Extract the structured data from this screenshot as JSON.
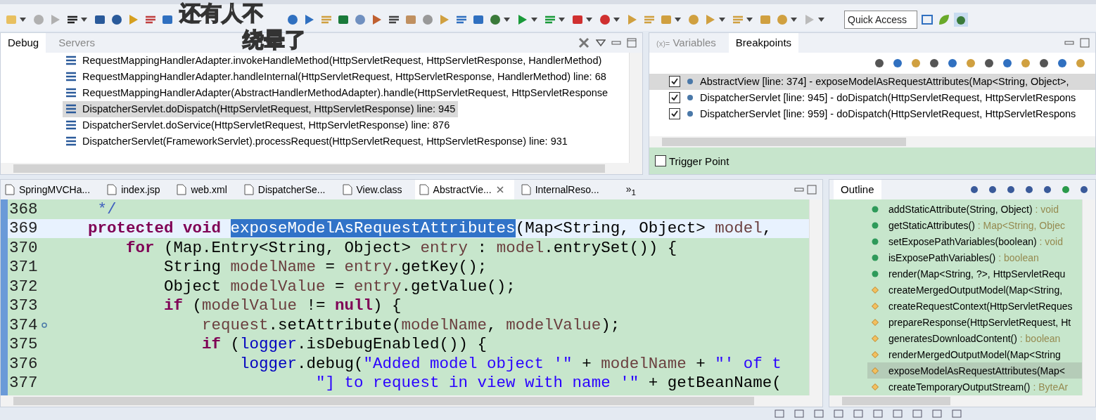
{
  "captions": [
    "还有人不",
    "绕晕了"
  ],
  "toolbar": {
    "quick_access": {
      "placeholder": "Quick Access"
    }
  },
  "debug_panel": {
    "tabs": [
      {
        "label": "Debug",
        "selected": true
      },
      {
        "label": "Servers",
        "selected": false
      }
    ],
    "frames": [
      {
        "text": "RequestMappingHandlerAdapter.invokeHandleMethod(HttpServletRequest, HttpServletResponse, HandlerMethod)",
        "selected": false
      },
      {
        "text": "RequestMappingHandlerAdapter.handleInternal(HttpServletRequest, HttpServletResponse, HandlerMethod) line: 68",
        "selected": false
      },
      {
        "text": "RequestMappingHandlerAdapter(AbstractHandlerMethodAdapter).handle(HttpServletRequest, HttpServletResponse",
        "selected": false
      },
      {
        "text": "DispatcherServlet.doDispatch(HttpServletRequest, HttpServletResponse) line: 945",
        "selected": true
      },
      {
        "text": "DispatcherServlet.doService(HttpServletRequest, HttpServletResponse) line: 876",
        "selected": false
      },
      {
        "text": "DispatcherServlet(FrameworkServlet).processRequest(HttpServletRequest, HttpServletResponse) line: 931",
        "selected": false
      }
    ]
  },
  "breakpoints_panel": {
    "tabs": [
      {
        "label": "Variables",
        "prefix": "(x)=",
        "selected": false
      },
      {
        "label": "Breakpoints",
        "selected": true
      }
    ],
    "breakpoints": [
      {
        "text": "AbstractView [line: 374] - exposeModelAsRequestAttributes(Map<String, Object>,",
        "checked": true,
        "selected": true
      },
      {
        "text": "DispatcherServlet [line: 945] - doDispatch(HttpServletRequest, HttpServletRespons",
        "checked": true,
        "selected": false
      },
      {
        "text": "DispatcherServlet [line: 959] - doDispatch(HttpServletRequest, HttpServletRespons",
        "checked": true,
        "selected": false
      }
    ],
    "trigger_point": {
      "label": "Trigger Point",
      "checked": false
    }
  },
  "editor": {
    "tabs": [
      {
        "label": "SpringMVCHa...",
        "selected": false
      },
      {
        "label": "index.jsp",
        "selected": false
      },
      {
        "label": "web.xml",
        "selected": false
      },
      {
        "label": "DispatcherSe...",
        "selected": false
      },
      {
        "label": "View.class",
        "selected": false
      },
      {
        "label": "AbstractVie...",
        "selected": true
      },
      {
        "label": "InternalReso...",
        "selected": false
      }
    ],
    "overflow": {
      "chevron": "»",
      "count": "1"
    },
    "lines": [
      {
        "number": "368",
        "current": false,
        "breakpoint": false,
        "segments": [
          {
            "text": "     */",
            "kind": "comment"
          }
        ]
      },
      {
        "number": "369",
        "current": true,
        "breakpoint": false,
        "segments": [
          {
            "text": "    protected void ",
            "kind": "keyword"
          },
          {
            "text": "exposeModelAsRequestAttributes",
            "kind": "selection"
          },
          {
            "text": "(Map<String, Object> ",
            "kind": "plain"
          },
          {
            "text": "model",
            "kind": "local"
          },
          {
            "text": ",",
            "kind": "plain"
          }
        ]
      },
      {
        "number": "370",
        "current": false,
        "breakpoint": false,
        "segments": [
          {
            "text": "        for",
            "kind": "keyword"
          },
          {
            "text": " (Map.Entry<String, Object> ",
            "kind": "plain"
          },
          {
            "text": "entry",
            "kind": "local"
          },
          {
            "text": " : ",
            "kind": "plain"
          },
          {
            "text": "model",
            "kind": "local"
          },
          {
            "text": ".entrySet()) {",
            "kind": "plain"
          }
        ]
      },
      {
        "number": "371",
        "current": false,
        "breakpoint": false,
        "segments": [
          {
            "text": "            String ",
            "kind": "plain"
          },
          {
            "text": "modelName",
            "kind": "local"
          },
          {
            "text": " = ",
            "kind": "plain"
          },
          {
            "text": "entry",
            "kind": "local"
          },
          {
            "text": ".getKey();",
            "kind": "plain"
          }
        ]
      },
      {
        "number": "372",
        "current": false,
        "breakpoint": false,
        "segments": [
          {
            "text": "            Object ",
            "kind": "plain"
          },
          {
            "text": "modelValue",
            "kind": "local"
          },
          {
            "text": " = ",
            "kind": "plain"
          },
          {
            "text": "entry",
            "kind": "local"
          },
          {
            "text": ".getValue();",
            "kind": "plain"
          }
        ]
      },
      {
        "number": "373",
        "current": false,
        "breakpoint": false,
        "segments": [
          {
            "text": "            if",
            "kind": "keyword"
          },
          {
            "text": " (",
            "kind": "plain"
          },
          {
            "text": "modelValue",
            "kind": "local"
          },
          {
            "text": " != ",
            "kind": "plain"
          },
          {
            "text": "null",
            "kind": "keyword"
          },
          {
            "text": ") {",
            "kind": "plain"
          }
        ]
      },
      {
        "number": "374",
        "current": false,
        "breakpoint": true,
        "segments": [
          {
            "text": "                request",
            "kind": "local"
          },
          {
            "text": ".setAttribute(",
            "kind": "plain"
          },
          {
            "text": "modelName",
            "kind": "local"
          },
          {
            "text": ", ",
            "kind": "plain"
          },
          {
            "text": "modelValue",
            "kind": "local"
          },
          {
            "text": ");",
            "kind": "plain"
          }
        ]
      },
      {
        "number": "375",
        "current": false,
        "breakpoint": false,
        "segments": [
          {
            "text": "                if",
            "kind": "keyword"
          },
          {
            "text": " (",
            "kind": "plain"
          },
          {
            "text": "logger",
            "kind": "field"
          },
          {
            "text": ".isDebugEnabled()) {",
            "kind": "plain"
          }
        ]
      },
      {
        "number": "376",
        "current": false,
        "breakpoint": false,
        "segments": [
          {
            "text": "                    logger",
            "kind": "field"
          },
          {
            "text": ".debug(",
            "kind": "plain"
          },
          {
            "text": "\"Added model object '\"",
            "kind": "string"
          },
          {
            "text": " + ",
            "kind": "plain"
          },
          {
            "text": "modelName",
            "kind": "local"
          },
          {
            "text": " + ",
            "kind": "plain"
          },
          {
            "text": "\"' of t",
            "kind": "string"
          }
        ]
      },
      {
        "number": "377",
        "current": false,
        "breakpoint": false,
        "segments": [
          {
            "text": "                            \"] to request in view with name '\"",
            "kind": "string"
          },
          {
            "text": " + getBeanName(",
            "kind": "plain"
          }
        ]
      }
    ]
  },
  "outline": {
    "title": "Outline",
    "items": [
      {
        "name": "addStaticAttribute(String, Object)",
        "type": " : void",
        "kind": "public",
        "selected": false
      },
      {
        "name": "getStaticAttributes()",
        "type": " : Map<String, Objec",
        "kind": "public",
        "selected": false
      },
      {
        "name": "setExposePathVariables(boolean)",
        "type": " : void",
        "kind": "public",
        "selected": false
      },
      {
        "name": "isExposePathVariables()",
        "type": " : boolean",
        "kind": "public",
        "selected": false
      },
      {
        "name": "render(Map<String, ?>, HttpServletRequ",
        "kind": "public",
        "selected": false
      },
      {
        "name": "createMergedOutputModel(Map<String,",
        "kind": "protected",
        "selected": false
      },
      {
        "name": "createRequestContext(HttpServletReques",
        "kind": "protected",
        "selected": false
      },
      {
        "name": "prepareResponse(HttpServletRequest, Ht",
        "kind": "protected",
        "selected": false
      },
      {
        "name": "generatesDownloadContent()",
        "type": " : boolean",
        "kind": "protected",
        "selected": false
      },
      {
        "name": "renderMergedOutputModel(Map<String",
        "kind": "protected",
        "selected": false
      },
      {
        "name": "exposeModelAsRequestAttributes(Map<",
        "kind": "protected",
        "selected": true
      },
      {
        "name": "createTemporaryOutputStream()",
        "type": " : ByteAr",
        "kind": "protected",
        "selected": false
      }
    ]
  }
}
